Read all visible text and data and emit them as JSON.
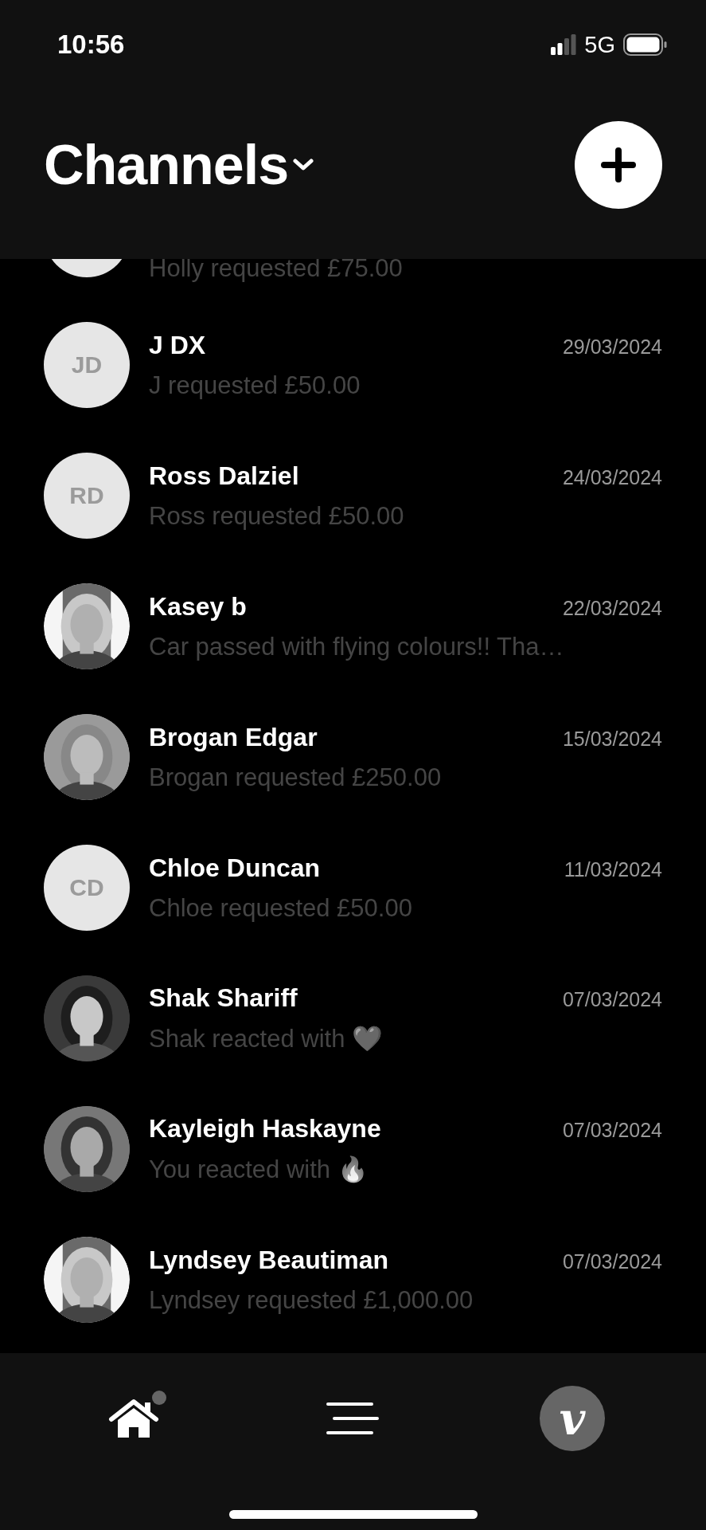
{
  "status_bar": {
    "time": "10:56",
    "network": "5G"
  },
  "header": {
    "title": "Channels"
  },
  "channels": [
    {
      "message": "Holly requested £75.00",
      "avatar": {
        "kind": "blank"
      }
    },
    {
      "name": "J DX",
      "message": "J requested £50.00",
      "date": "29/03/2024",
      "avatar": {
        "kind": "initials",
        "initials": "JD"
      }
    },
    {
      "name": "Ross Dalziel",
      "message": "Ross requested £50.00",
      "date": "24/03/2024",
      "avatar": {
        "kind": "initials",
        "initials": "RD"
      }
    },
    {
      "name": "Kasey b",
      "message": "Car passed with flying colours!! Tha…",
      "date": "22/03/2024"
    },
    {
      "name": "Brogan Edgar",
      "message": "Brogan requested £250.00",
      "date": "15/03/2024"
    },
    {
      "name": "Chloe Duncan",
      "message": "Chloe requested £50.00",
      "date": "11/03/2024",
      "avatar": {
        "kind": "initials",
        "initials": "CD"
      }
    },
    {
      "name": "Shak Shariff",
      "message": "Shak reacted with ❤️",
      "date": "07/03/2024"
    },
    {
      "name": "Kayleigh Haskayne",
      "message": "You reacted with 🔥",
      "date": "07/03/2024"
    },
    {
      "name": "Lyndsey Beautiman",
      "message": "Lyndsey requested £1,000.00",
      "date": "07/03/2024"
    }
  ],
  "nav": [
    {
      "kind": "home",
      "badge": true
    },
    {
      "kind": "menu",
      "badge": false
    },
    {
      "kind": "logo",
      "letter": "v",
      "badge": false
    }
  ]
}
